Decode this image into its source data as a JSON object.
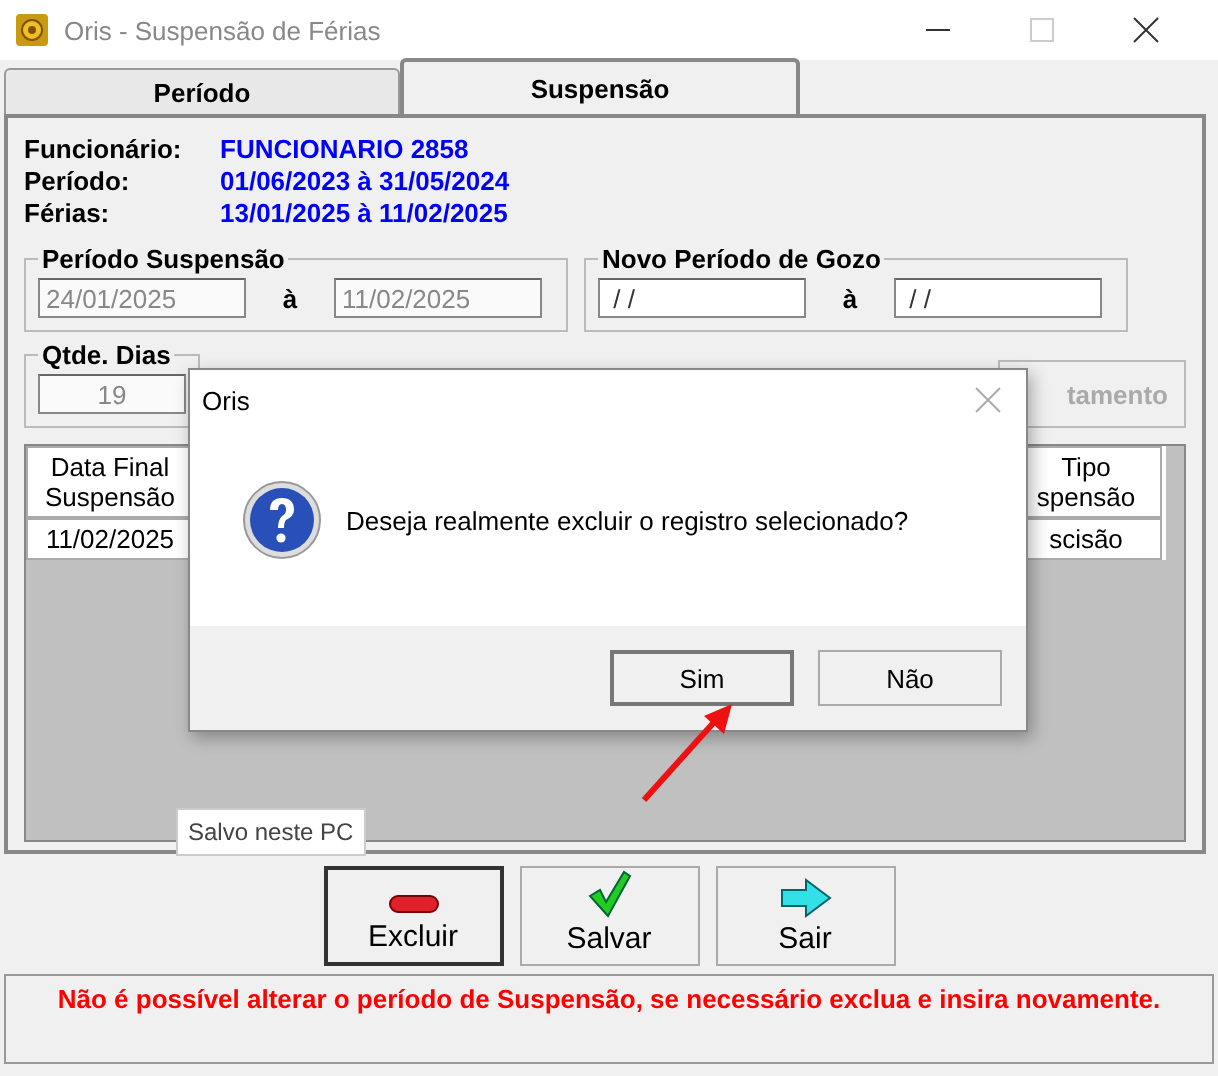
{
  "window": {
    "title": "Oris - Suspensão de Férias"
  },
  "tabs": [
    {
      "label": "Período",
      "selected": false
    },
    {
      "label": "Suspensão",
      "selected": true
    }
  ],
  "info": [
    {
      "label": "Funcionário:",
      "value": "FUNCIONARIO 2858"
    },
    {
      "label": "Período:",
      "value": "01/06/2023 à 31/05/2024"
    },
    {
      "label": "Férias:",
      "value": "13/01/2025 à 11/02/2025"
    }
  ],
  "groups": [
    {
      "title": "Período Suspensão",
      "from": {
        "value": "24/01/2025",
        "disabled": true
      },
      "separator": "à",
      "to": {
        "value": "11/02/2025",
        "disabled": true
      }
    },
    {
      "title": "Novo Período de Gozo",
      "from": {
        "value": " / /",
        "disabled": false
      },
      "separator": "à",
      "to": {
        "value": " / /",
        "disabled": false
      }
    }
  ],
  "qtde": {
    "title": "Qtde. Dias",
    "field": {
      "value": "19",
      "disabled": true
    }
  },
  "side_button": {
    "label": "tamento",
    "disabled": true
  },
  "table": {
    "columns": [
      "Data Final\nSuspensão",
      "Tipo\nspensão"
    ],
    "rows": [
      [
        "11/02/2025",
        "scisão"
      ]
    ]
  },
  "tooltip": "Salvo neste PC",
  "buttons": [
    {
      "label": "Excluir",
      "kind": "delete",
      "selected": true
    },
    {
      "label": "Salvar",
      "kind": "save",
      "selected": false
    },
    {
      "label": "Sair",
      "kind": "exit",
      "selected": false
    }
  ],
  "status": "Não é possível alterar o período de Suspensão, se necessário exclua e insira novamente.",
  "dialog": {
    "title": "Oris",
    "message": "Deseja realmente excluir o registro selecionado?",
    "buttons": [
      {
        "label": "Sim",
        "selected": true
      },
      {
        "label": "Não",
        "selected": false
      }
    ]
  }
}
